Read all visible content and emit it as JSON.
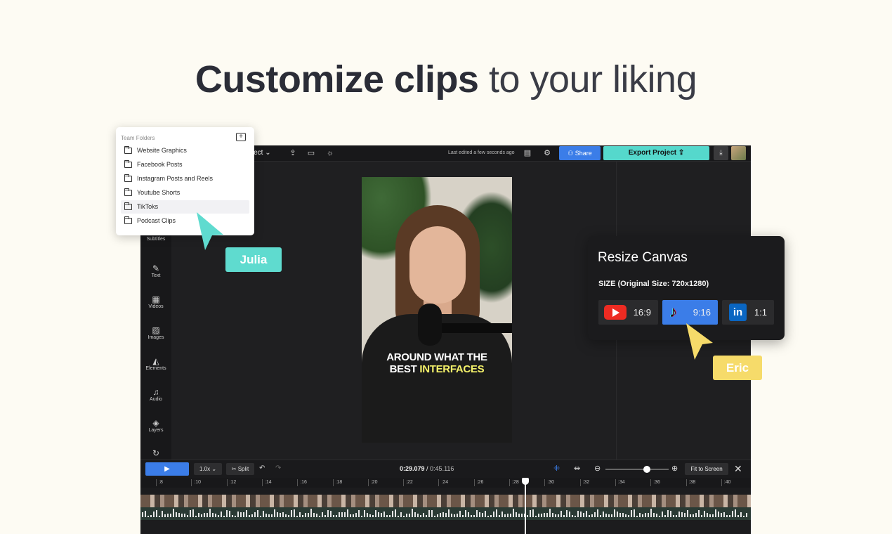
{
  "headline": {
    "bold": "Customize clips",
    "light": " to your liking"
  },
  "editor": {
    "project_name": "roject",
    "last_edited": "Last edited a few seconds ago",
    "share_label": "Share",
    "export_label": "Export Project",
    "tools": [
      "Subtitles",
      "Text",
      "Videos",
      "Images",
      "Elements",
      "Audio",
      "Layers"
    ],
    "caption_line1": "AROUND WHAT THE",
    "caption_line2_plain": "BEST ",
    "caption_line2_highlight": "INTERFACES",
    "speed": "1.0x",
    "split_label": "Split",
    "time_current": "0:29.079",
    "time_total": "0:45.116",
    "fit_label": "Fit to Screen",
    "ruler_ticks": [
      ":8",
      ":10",
      ":12",
      ":14",
      ":16",
      ":18",
      ":20",
      ":22",
      ":24",
      ":26",
      ":28",
      ":30",
      ":32",
      ":34",
      ":36",
      ":38",
      ":40"
    ]
  },
  "folders": {
    "title": "Team Folders",
    "items": [
      "Website Graphics",
      "Facebook Posts",
      "Instagram Posts and Reels",
      "Youtube Shorts",
      "TikToks",
      "Podcast Clips"
    ],
    "active_index": 4
  },
  "cursors": {
    "julia": "Julia",
    "eric": "Eric",
    "julia_color": "#5fdbcf",
    "eric_color": "#f6db6a"
  },
  "resize": {
    "title": "Resize Canvas",
    "size_label": "SIZE (Original Size: 720x1280)",
    "options": [
      {
        "label": "16:9",
        "icon": "youtube-icon"
      },
      {
        "label": "9:16",
        "icon": "tiktok-icon",
        "selected": true
      },
      {
        "label": "1:1",
        "icon": "linkedin-icon"
      }
    ]
  },
  "colors": {
    "accent_blue": "#3b7de8",
    "export_teal": "#55d8cc"
  }
}
